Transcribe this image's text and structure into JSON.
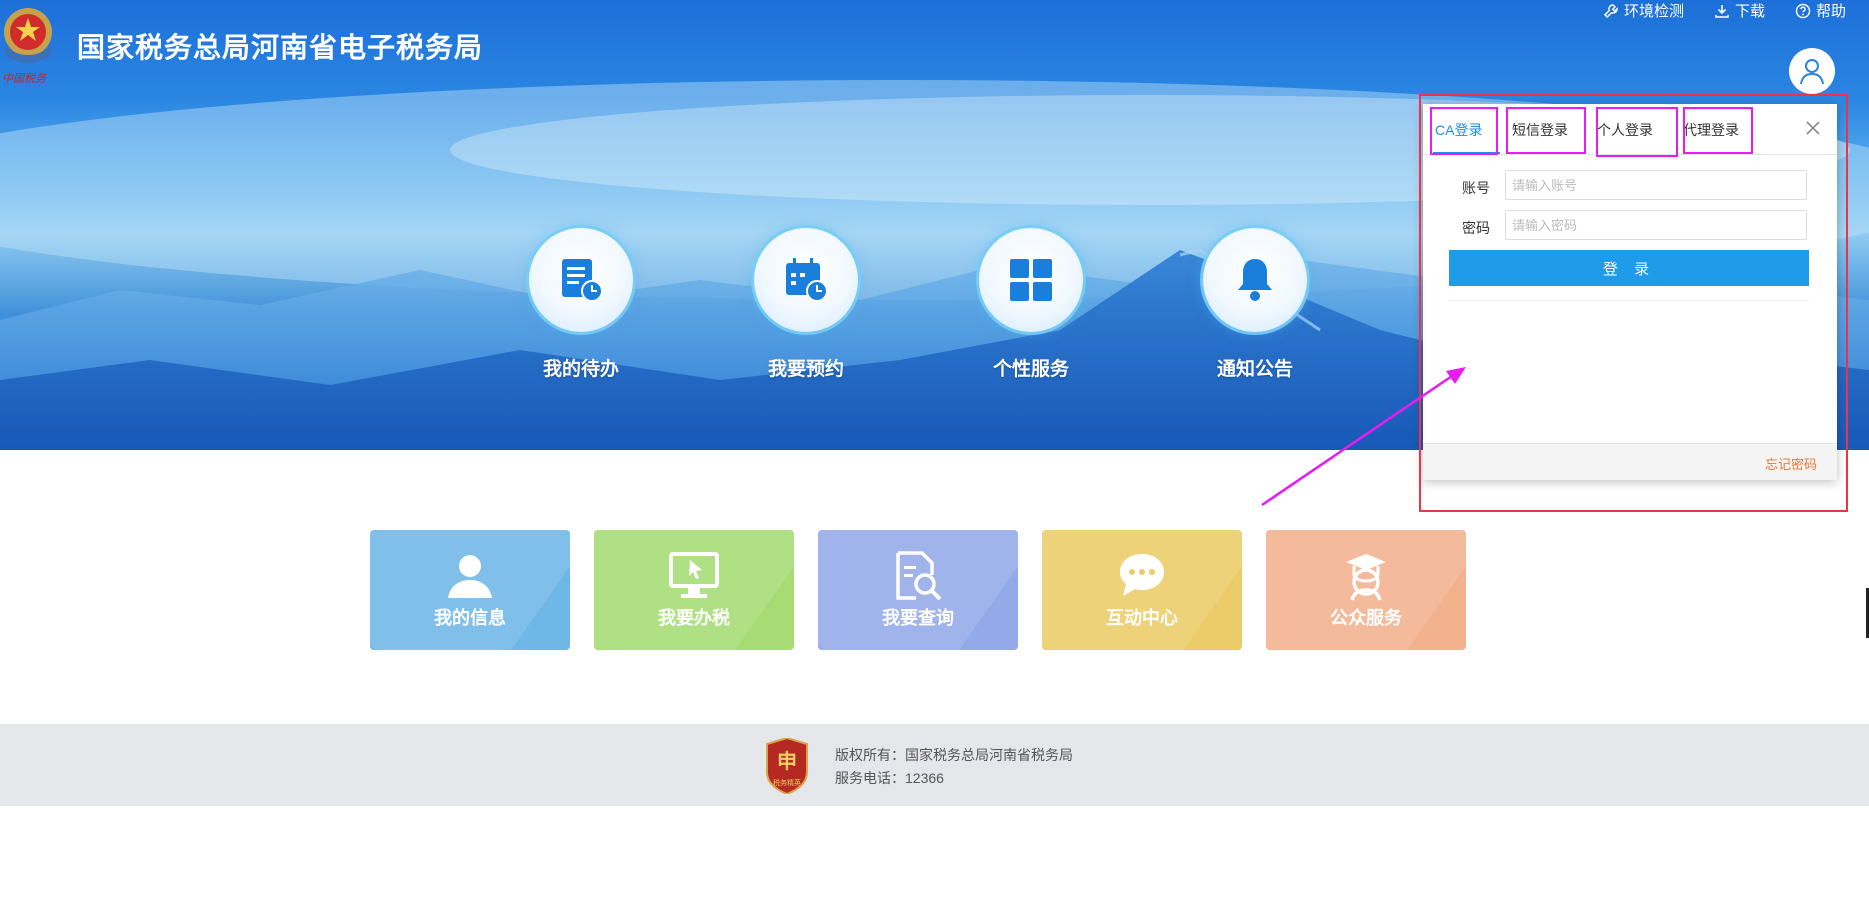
{
  "header": {
    "site_title": "国家税务总局河南省电子税务局",
    "emblem_text": "中国税务",
    "links": [
      {
        "label": "环境检测",
        "icon": "wrench-icon"
      },
      {
        "label": "下载",
        "icon": "download-icon"
      },
      {
        "label": "帮助",
        "icon": "help-icon"
      }
    ],
    "avatar_icon": "user-icon"
  },
  "quick_entries": [
    {
      "label": "我的待办",
      "icon": "todo-list-icon"
    },
    {
      "label": "我要预约",
      "icon": "calendar-clock-icon"
    },
    {
      "label": "个性服务",
      "icon": "grid-icon"
    },
    {
      "label": "通知公告",
      "icon": "bell-icon"
    }
  ],
  "tiles": [
    {
      "label": "我的信息",
      "icon": "person-icon",
      "color": "#6fb7e6"
    },
    {
      "label": "我要办税",
      "icon": "monitor-cursor-icon",
      "color": "#a6dc73"
    },
    {
      "label": "我要查询",
      "icon": "document-search-icon",
      "color": "#93a9e8"
    },
    {
      "label": "互动中心",
      "icon": "chat-bubble-icon",
      "color": "#ebcc68"
    },
    {
      "label": "公众服务",
      "icon": "graduate-icon",
      "color": "#f2b28e"
    }
  ],
  "login_panel": {
    "tabs": [
      "CA登录",
      "短信登录",
      "个人登录",
      "代理登录"
    ],
    "active_tab": "CA登录",
    "account_label": "账号",
    "account_placeholder": "请输入账号",
    "account_value": "",
    "password_label": "密码",
    "password_placeholder": "请输入密码",
    "password_value": "",
    "login_button": "登 录",
    "forgot_password": "忘记密码"
  },
  "footer": {
    "copyright": "版权所有：国家税务总局河南省税务局",
    "phone": "服务电话：12366",
    "logo_text": "税务精英"
  },
  "colors": {
    "primary": "#1e9be9",
    "annotation_red": "#ee3348",
    "annotation_magenta": "#e81cf0",
    "forgot_link": "#e8772e"
  }
}
